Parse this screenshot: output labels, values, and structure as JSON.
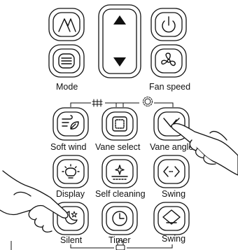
{
  "labels": {
    "mode": "Mode",
    "fan_speed": "Fan speed",
    "soft_wind": "Soft wind",
    "vane_select": "Vane select",
    "vane_angle": "Vane angle",
    "display": "Display",
    "self_cleaning": "Self cleaning",
    "swing_1": "Swing",
    "silent": "Silent",
    "timer": "Timer",
    "swing_2": "Swing"
  },
  "icons": {
    "top_left": "mountain-logo-icon",
    "updown": "up-down-arrows-icon",
    "power": "power-icon",
    "mode": "menu-lines-icon",
    "fan_speed": "fan-icon",
    "group_vent": "vent-grille-icon",
    "group_gear": "gear-icon",
    "soft_wind": "wind-leaf-icon",
    "vane_select": "square-frame-icon",
    "vane_angle": "vane-angle-icon",
    "display": "bulb-icon",
    "self_cleaning": "sparkle-clean-icon",
    "swing_1": "left-right-swing-icon",
    "silent": "moon-star-icon",
    "timer": "clock-icon",
    "swing_2": "up-down-swing-icon",
    "group_lock": "lock-icon"
  }
}
